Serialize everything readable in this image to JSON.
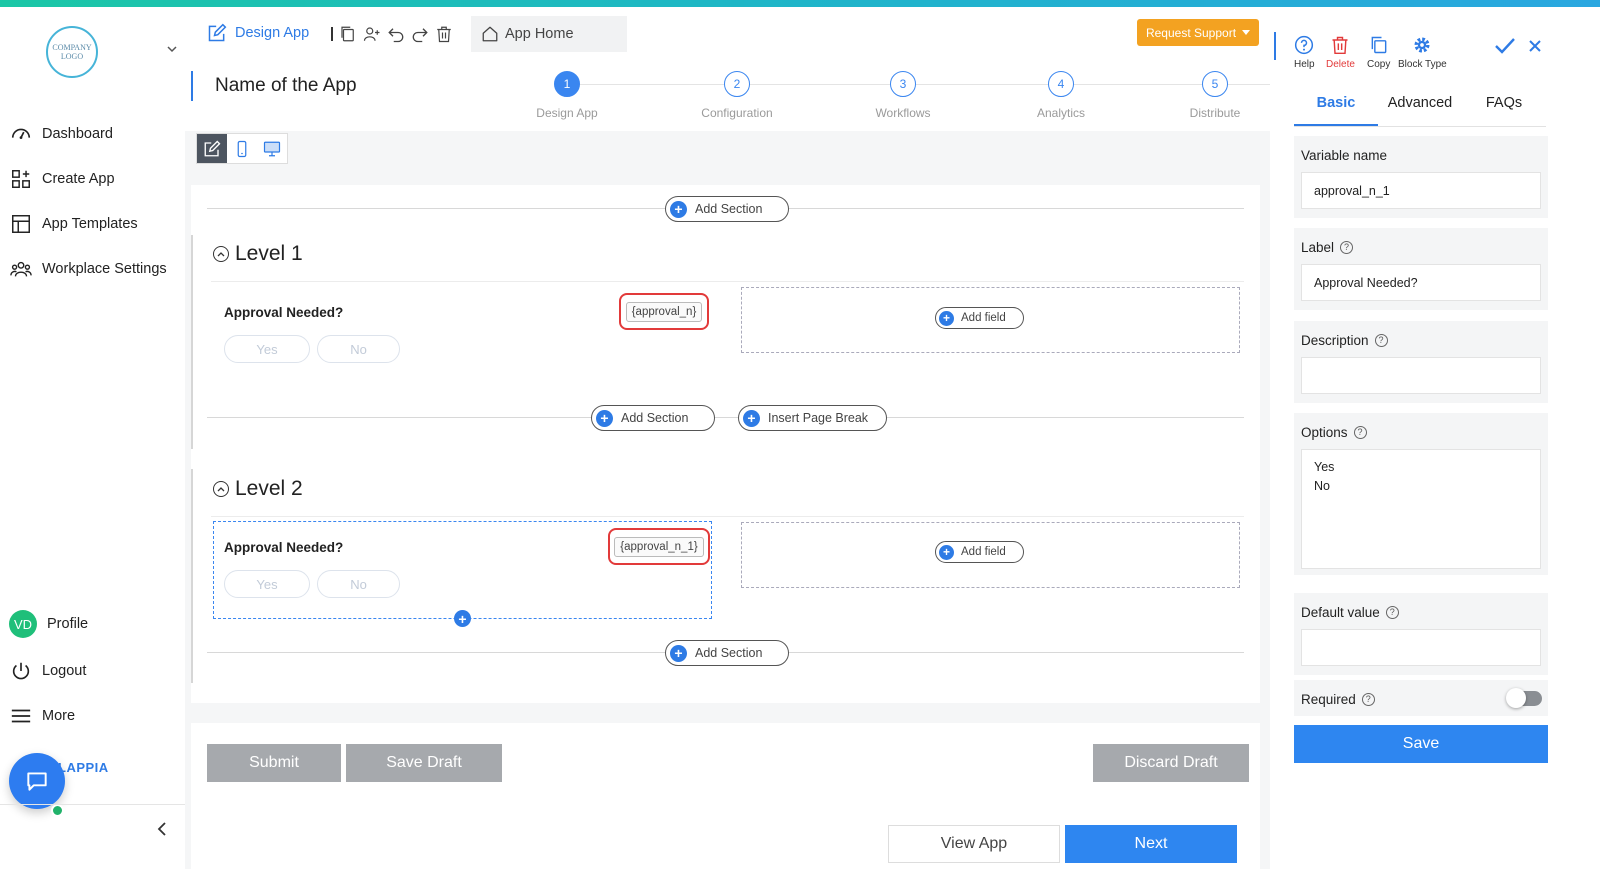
{
  "sidebar": {
    "logo_text": "COMPANY LOGO",
    "nav": [
      {
        "label": "Dashboard"
      },
      {
        "label": "Create App"
      },
      {
        "label": "App Templates"
      },
      {
        "label": "Workplace Settings"
      }
    ],
    "profile": {
      "initials": "VD",
      "label": "Profile"
    },
    "logout": "Logout",
    "more": "More",
    "brand": "LAPPIA"
  },
  "toolbar": {
    "design_label": "Design App",
    "home_label": "App Home",
    "support_label": "Request Support"
  },
  "header": {
    "app_name": "Name of the App",
    "steps": [
      {
        "num": "1",
        "label": "Design App",
        "active": true
      },
      {
        "num": "2",
        "label": "Configuration"
      },
      {
        "num": "3",
        "label": "Workflows"
      },
      {
        "num": "4",
        "label": "Analytics"
      },
      {
        "num": "5",
        "label": "Distribute"
      }
    ]
  },
  "canvas": {
    "add_section": "Add Section",
    "insert_page_break": "Insert Page Break",
    "add_field": "Add field",
    "levels": [
      {
        "title": "Level 1",
        "question": "Approval Needed?",
        "var": "{approval_n}",
        "options": [
          "Yes",
          "No"
        ]
      },
      {
        "title": "Level 2",
        "question": "Approval Needed?",
        "var": "{approval_n_1}",
        "options": [
          "Yes",
          "No"
        ]
      }
    ]
  },
  "footer": {
    "submit": "Submit",
    "save_draft": "Save Draft",
    "discard_draft": "Discard Draft",
    "view_app": "View App",
    "next": "Next"
  },
  "panel": {
    "tools": [
      {
        "label": "Help",
        "icon": "help-icon"
      },
      {
        "label": "Delete",
        "icon": "trash-icon",
        "color": "#e23a3a"
      },
      {
        "label": "Copy",
        "icon": "copy-icon"
      },
      {
        "label": "Block Type",
        "icon": "gear-icon"
      }
    ],
    "tabs": [
      "Basic",
      "Advanced",
      "FAQs"
    ],
    "variable_name_label": "Variable name",
    "variable_name_value": "approval_n_1",
    "label_label": "Label",
    "label_value": "Approval Needed?",
    "description_label": "Description",
    "description_value": "",
    "options_label": "Options",
    "options_value": "Yes\nNo",
    "default_label": "Default value",
    "default_value": "",
    "required_label": "Required",
    "required_on": false,
    "save": "Save"
  },
  "colors": {
    "accent": "#2e7be5",
    "support": "#f3a221",
    "danger": "#e23a3a"
  }
}
